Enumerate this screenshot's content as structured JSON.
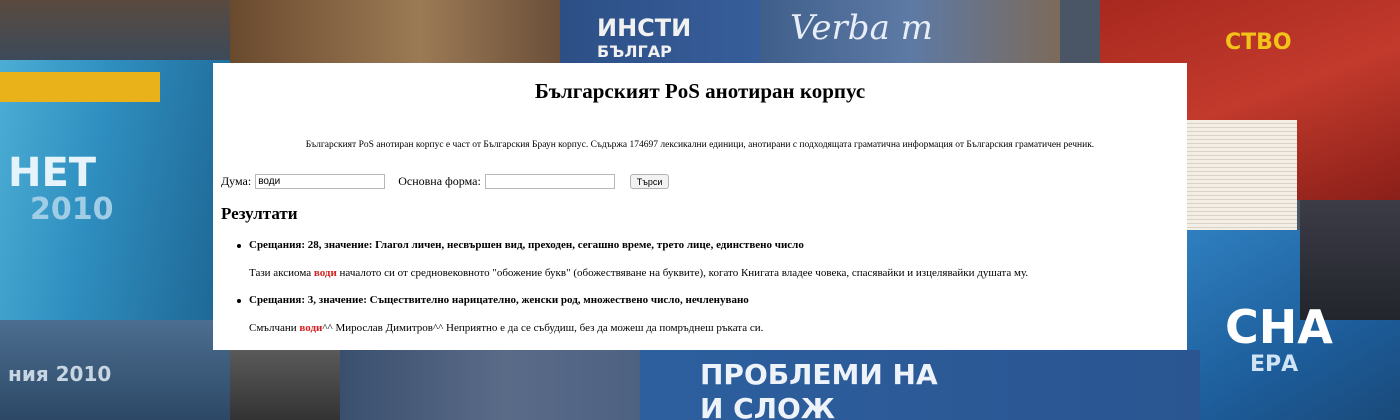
{
  "page": {
    "title": "Българският PoS анотиран корпус",
    "description": "Българският PoS анотиран корпус е част от Българския Браун корпус. Съдържа 174697 лексикални единици, анотирани с подходящата граматична информация от Българския граматичен речник."
  },
  "search": {
    "word_label": "Дума:",
    "word_value": "води",
    "base_label": "Основна форма:",
    "base_value": "",
    "submit_label": "Търси"
  },
  "results": {
    "heading": "Резултати",
    "items": [
      {
        "summary": "Срещания: 28, значение: Глагол личен, несвършен вид, преходен, сегашно време, трето лице, единствено число",
        "before": "Тази аксиома ",
        "match": "води",
        "after": " началото си от средновековното \"обожение букв\" (обожествяване на буквите), когато Книгата владее човека, спасявайки и изцелявайки душата му."
      },
      {
        "summary": "Срещания: 3, значение: Съществително нарицателно, женски род, множествено число, нечленувано",
        "before": "Смълчани ",
        "match": "води",
        "after": "^^ Мирослав Димитров^^ Неприятно е да се събудиш, без да можеш да помръднеш ръката си."
      }
    ]
  },
  "background": {
    "book_texts": [
      "НЕТ",
      "2010",
      "ния 2010",
      "ИНСТИ",
      "БЪЛГАР",
      "Verba m",
      "СТВО",
      "СНА",
      "ЕРА",
      "ПРОБЛЕМИ НА",
      "И СЛОЖ"
    ]
  }
}
